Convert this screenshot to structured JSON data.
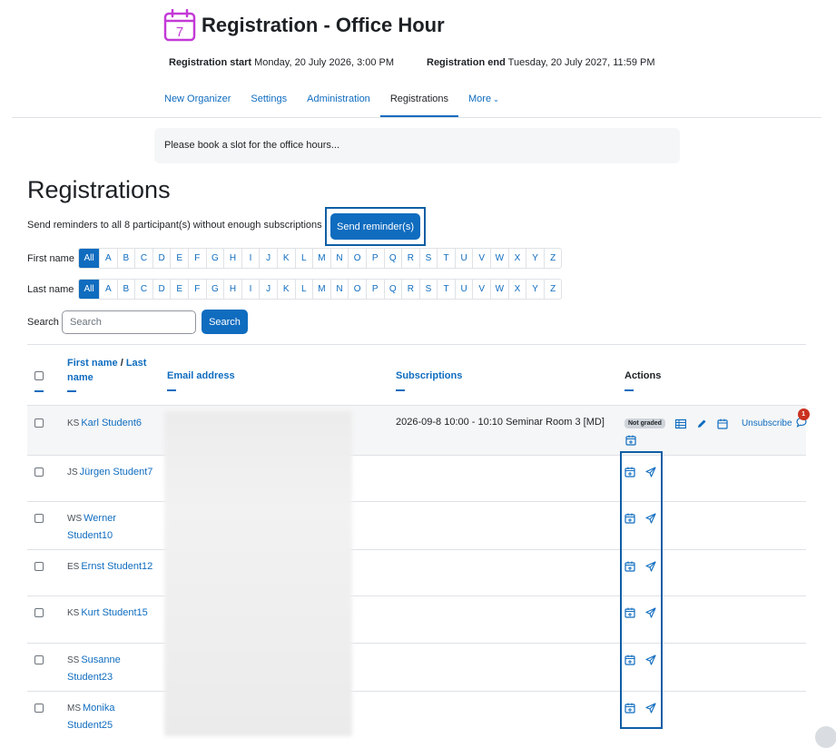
{
  "header": {
    "title": "Registration - Office Hour",
    "calendar_day": "7",
    "reg_start_label": "Registration start",
    "reg_start_value": "Monday, 20 July 2026, 3:00 PM",
    "reg_end_label": "Registration end",
    "reg_end_value": "Tuesday, 20 July 2027, 11:59 PM"
  },
  "tabs": [
    {
      "label": "New Organizer"
    },
    {
      "label": "Settings"
    },
    {
      "label": "Administration"
    },
    {
      "label": "Registrations",
      "active": true
    },
    {
      "label": "More"
    }
  ],
  "intro": "Please book a slot for the office hours...",
  "section_title": "Registrations",
  "reminder": {
    "text": "Send reminders to all 8 participant(s) without enough subscriptions",
    "button": "Send reminder(s)"
  },
  "filters": {
    "first_name_label": "First name",
    "last_name_label": "Last name",
    "all_label": "All",
    "letters": [
      "A",
      "B",
      "C",
      "D",
      "E",
      "F",
      "G",
      "H",
      "I",
      "J",
      "K",
      "L",
      "M",
      "N",
      "O",
      "P",
      "Q",
      "R",
      "S",
      "T",
      "U",
      "V",
      "W",
      "X",
      "Y",
      "Z"
    ]
  },
  "search": {
    "label": "Search",
    "placeholder": "Search",
    "button": "Search"
  },
  "table": {
    "col_first_name": "First name",
    "col_sep": " / ",
    "col_last_name": "Last name",
    "col_email": "Email address",
    "col_subscriptions": "Subscriptions",
    "col_actions": "Actions",
    "rows": [
      {
        "initials": "KS",
        "name": "Karl Student6",
        "subscription": "2026-09-8   10:00 - 10:10 Seminar Room 3 [MD]",
        "badge": "Not graded",
        "unsubscribe": "Unsubscribe",
        "message_count": "1"
      },
      {
        "initials": "JS",
        "name": "Jürgen Student7",
        "subscription": ""
      },
      {
        "initials": "WS",
        "name": "Werner Student10",
        "subscription": ""
      },
      {
        "initials": "ES",
        "name": "Ernst Student12",
        "subscription": ""
      },
      {
        "initials": "KS",
        "name": "Kurt Student15",
        "subscription": ""
      },
      {
        "initials": "SS",
        "name": "Susanne Student23",
        "subscription": ""
      },
      {
        "initials": "MS",
        "name": "Monika Student25",
        "subscription": ""
      }
    ]
  },
  "colors": {
    "primary": "#0f6cbf",
    "accent_purple": "#c33ad6",
    "badge_red": "#ca3120"
  }
}
